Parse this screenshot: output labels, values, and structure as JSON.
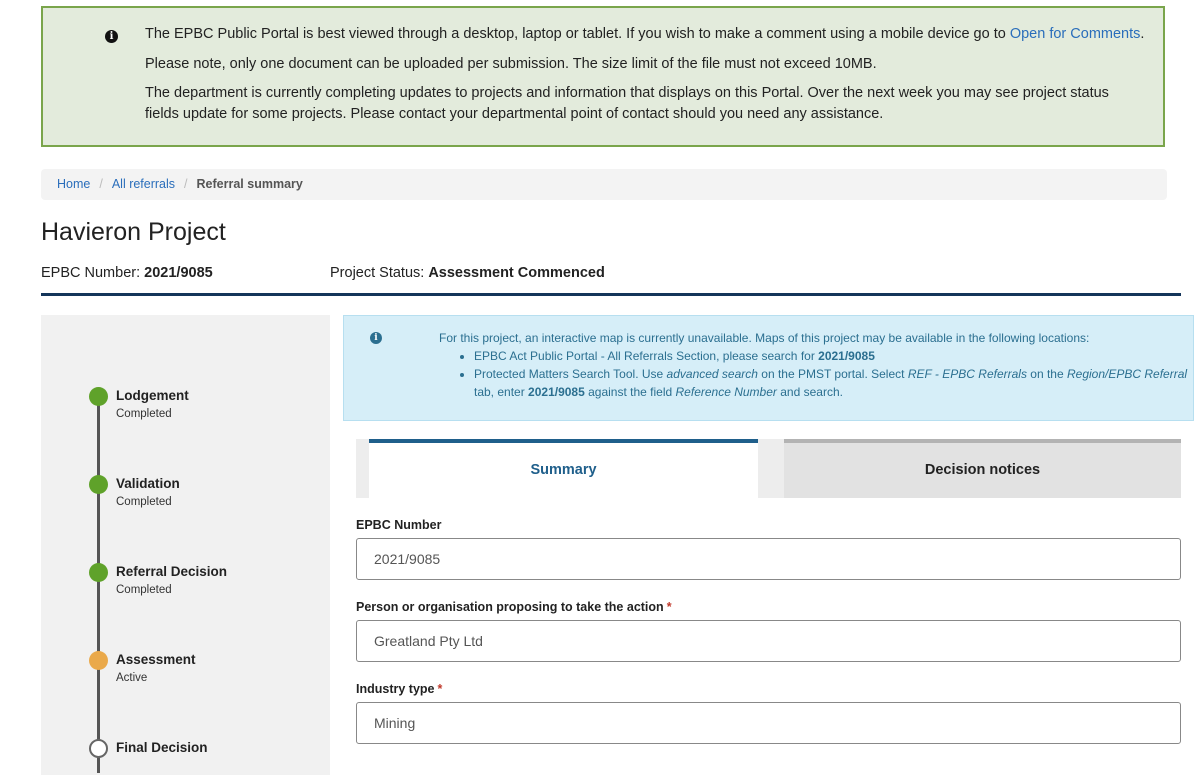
{
  "notice": {
    "line1_text": "The EPBC Public Portal is best viewed through a desktop, laptop or tablet.  If you wish to make a comment using a mobile device go to ",
    "line1_link": "Open for Comments",
    "line1_end": ".",
    "line2": "Please note, only one document can be uploaded per submission. The size limit of the file must not exceed 10MB.",
    "line3": "The department is currently completing updates to projects and information that displays on this Portal. Over the next week you may see project status fields update for some projects. Please contact your departmental point of contact should you need any assistance."
  },
  "breadcrumb": {
    "home": "Home",
    "sep": "/",
    "all_referrals": "All referrals",
    "current": "Referral summary"
  },
  "project": {
    "title": "Havieron Project",
    "epbc_label": "EPBC Number: ",
    "epbc_value": "2021/9085",
    "status_label": "Project Status: ",
    "status_value": "Assessment Commenced"
  },
  "progress": {
    "steps": [
      {
        "name": "Lodgement",
        "state": "Completed"
      },
      {
        "name": "Validation",
        "state": "Completed"
      },
      {
        "name": "Referral Decision",
        "state": "Completed"
      },
      {
        "name": "Assessment",
        "state": "Active"
      },
      {
        "name": "Final Decision",
        "state": ""
      }
    ]
  },
  "map_info": {
    "intro": "For this project, an interactive map is currently unavailable. Maps of this project may be available in the following locations:",
    "item1_text": "EPBC Act Public Portal - All Referrals Section, please search for ",
    "item1_bold": "2021/9085",
    "item2_a": "Protected Matters Search Tool. Use ",
    "item2_em1": "advanced search",
    "item2_b": " on the PMST portal. Select ",
    "item2_em2": "REF - EPBC Referrals",
    "item2_c": " on the ",
    "item2_em3": "Region/EPBC Referral",
    "item2_d": " tab, enter ",
    "item2_bold": "2021/9085",
    "item2_e": " against the field ",
    "item2_em4": "Reference Number",
    "item2_f": " and search."
  },
  "tabs": {
    "summary": "Summary",
    "decisions": "Decision notices"
  },
  "form": {
    "epbc_label": "EPBC Number",
    "epbc_value": "2021/9085",
    "person_label": "Person or organisation proposing to take the action",
    "person_value": "Greatland Pty Ltd",
    "industry_label": "Industry type",
    "industry_value": "Mining",
    "required_mark": "*"
  },
  "colors": {
    "notice_bg": "#e3ebdc",
    "notice_border": "#7aa54b",
    "link": "#2a6ebb",
    "step_done": "#5fa22a",
    "step_active": "#eaa94a",
    "tab_active": "#1f5f8b",
    "rule": "#14355a",
    "mapinfo_bg": "#d6eef8"
  },
  "icons": {
    "notice": "info-icon",
    "mapinfo": "info-icon"
  }
}
